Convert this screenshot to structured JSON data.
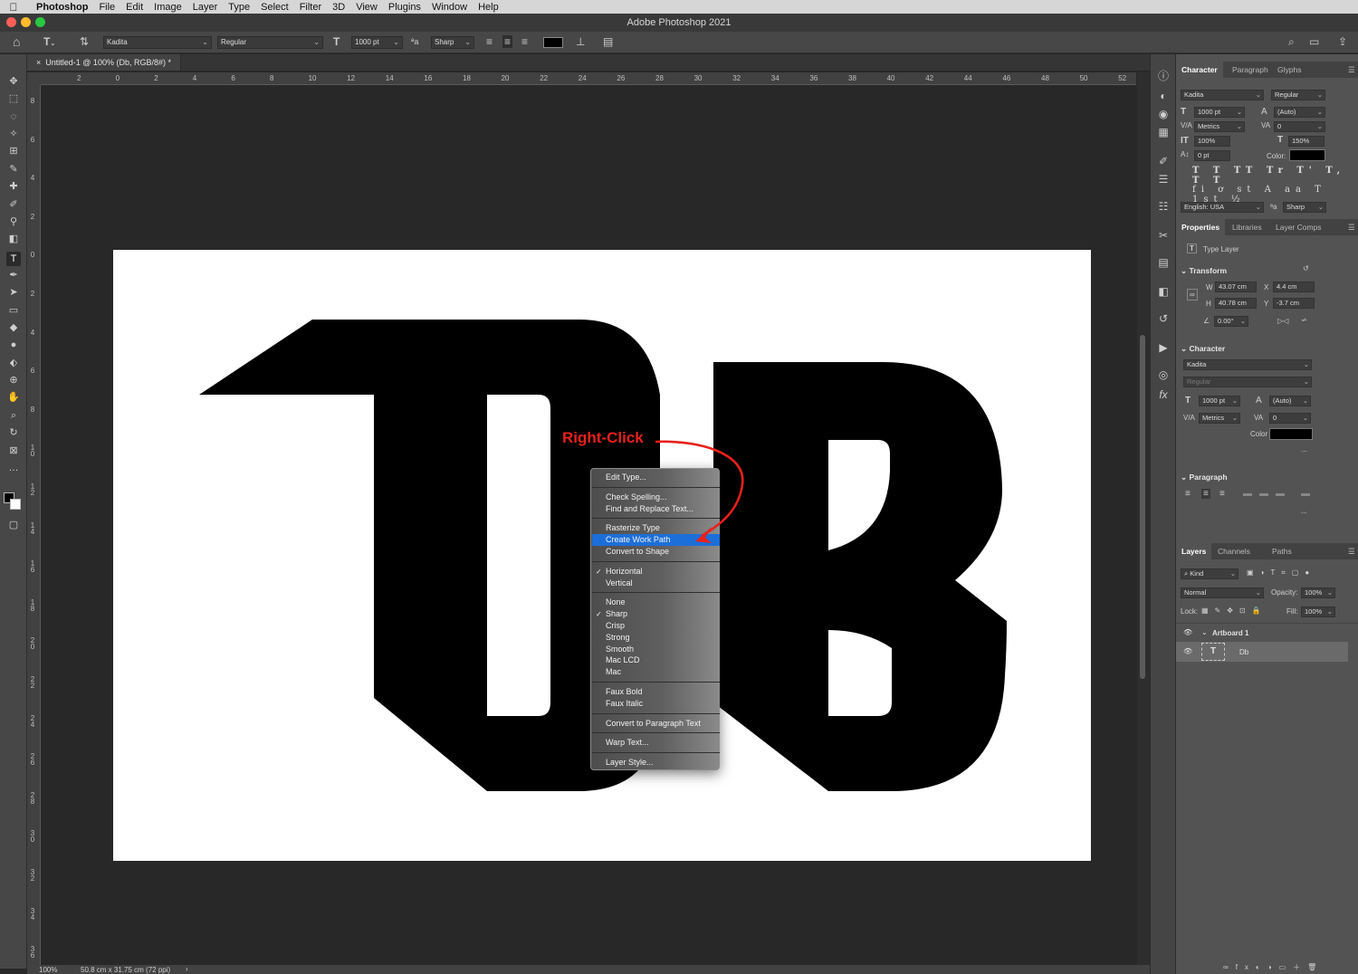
{
  "menubar": {
    "app": "Photoshop",
    "items": [
      "File",
      "Edit",
      "Image",
      "Layer",
      "Type",
      "Select",
      "Filter",
      "3D",
      "View",
      "Plugins",
      "Window",
      "Help"
    ]
  },
  "window": {
    "title": "Adobe Photoshop 2021"
  },
  "options": {
    "font_family": "Kadita",
    "font_style": "Regular",
    "font_size": "1000 pt",
    "antialias": "Sharp",
    "color": "#000000"
  },
  "document": {
    "tab_close": "×",
    "tab_label": "Untitled-1 @ 100% (Db, RGB/8#) *",
    "canvas_text": "DB"
  },
  "rulers": {
    "top": [
      "2",
      "0",
      "2",
      "4",
      "6",
      "8",
      "10",
      "12",
      "14",
      "16",
      "18",
      "20",
      "22",
      "24",
      "26",
      "28",
      "30",
      "32",
      "34",
      "36",
      "38",
      "40",
      "42",
      "44",
      "46",
      "48",
      "50",
      "52"
    ],
    "left": [
      "8",
      "6",
      "4",
      "2",
      "0",
      "2",
      "4",
      "6",
      "8",
      "10",
      "12",
      "14",
      "16",
      "18",
      "20",
      "22",
      "24",
      "26",
      "28",
      "30",
      "32",
      "34",
      "36"
    ]
  },
  "status": {
    "zoom": "100%",
    "doc_size": "50.8 cm x 31.75 cm (72 ppi)",
    "more": "›"
  },
  "annotation": {
    "label": "Right-Click",
    "color": "#e8211b"
  },
  "context_menu": {
    "items": [
      {
        "label": "Edit Type..."
      },
      {
        "label": "Check Spelling..."
      },
      {
        "label": "Find and Replace Text..."
      },
      {
        "label": "Rasterize Type"
      },
      {
        "label": "Create Work Path",
        "highlighted": true
      },
      {
        "label": "Convert to Shape"
      },
      {
        "label": "Horizontal",
        "checked": true
      },
      {
        "label": "Vertical"
      },
      {
        "label": "None"
      },
      {
        "label": "Sharp",
        "checked": true
      },
      {
        "label": "Crisp"
      },
      {
        "label": "Strong"
      },
      {
        "label": "Smooth"
      },
      {
        "label": "Mac LCD"
      },
      {
        "label": "Mac"
      },
      {
        "label": "Faux Bold"
      },
      {
        "label": "Faux Italic"
      },
      {
        "label": "Convert to Paragraph Text"
      },
      {
        "label": "Warp Text..."
      },
      {
        "label": "Layer Style..."
      }
    ],
    "check_glyph": "✓",
    "highlight_color": "#1c6fd9"
  },
  "character_panel": {
    "tabs": [
      "Character",
      "Paragraph",
      "Glyphs"
    ],
    "font": "Kadita",
    "style": "Regular",
    "size": "1000 pt",
    "leading": "(Auto)",
    "kerning": "Metrics",
    "tracking": "0",
    "vscale": "100%",
    "hscale": "150%",
    "baseline": "0 pt",
    "color_label": "Color:",
    "language": "English: USA",
    "antialias": "Sharp",
    "glyph_row1": "T T TT Tr T' T, T T",
    "glyph_row2": "fi ơ st A aa T 1st ½"
  },
  "properties_panel": {
    "tabs": [
      "Properties",
      "Libraries",
      "Layer Comps"
    ],
    "layer_type": "Type Layer",
    "transform_title": "Transform",
    "w_label": "W",
    "w": "43.07 cm",
    "x_label": "X",
    "x": "4.4 cm",
    "h_label": "H",
    "h": "40.78 cm",
    "y_label": "Y",
    "y": "-3.7 cm",
    "angle": "0.00°",
    "character_title": "Character",
    "font": "Kadita",
    "style": "Regular",
    "size": "1000 pt",
    "leading": "(Auto)",
    "kerning": "Metrics",
    "tracking": "0",
    "color_label": "Color",
    "paragraph_title": "Paragraph",
    "more": "..."
  },
  "layers_panel": {
    "tabs": [
      "Layers",
      "Channels",
      "Paths"
    ],
    "kind": "Kind",
    "blend": "Normal",
    "opacity_label": "Opacity:",
    "opacity": "100%",
    "lock_label": "Lock:",
    "fill_label": "Fill:",
    "fill": "100%",
    "layers": [
      {
        "name": "Artboard 1",
        "type": "artboard"
      },
      {
        "name": "Db",
        "type": "text",
        "selected": true
      }
    ]
  }
}
